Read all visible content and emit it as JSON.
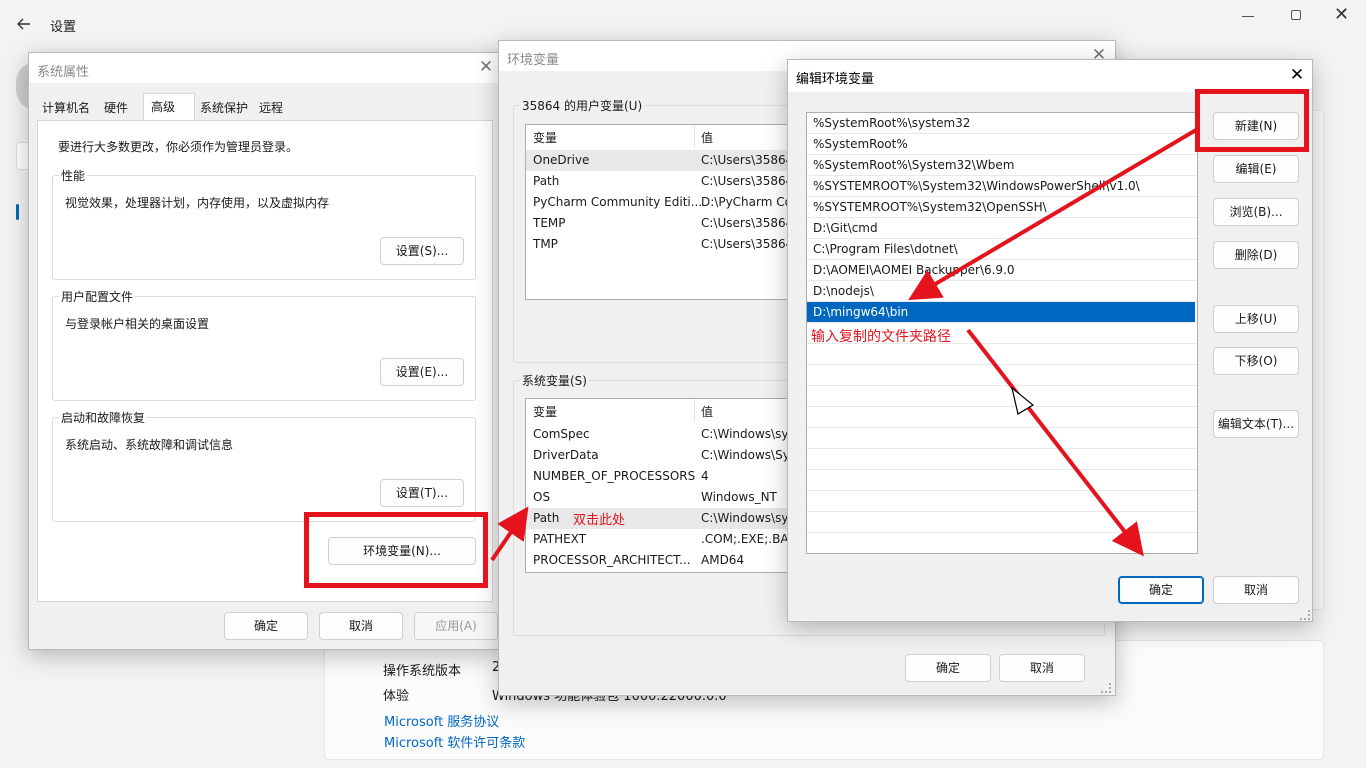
{
  "settings": {
    "title": "设置",
    "rows": [
      {
        "label": "操作系统版本",
        "value": "2"
      },
      {
        "label": "体验",
        "value": "Windows 功能体验包 1000.22000.0.0"
      }
    ],
    "links": [
      "Microsoft 服务协议",
      "Microsoft 软件许可条款"
    ]
  },
  "sysprops": {
    "title": "系统属性",
    "tabs": [
      "计算机名",
      "硬件",
      "高级",
      "系统保护",
      "远程"
    ],
    "active_tab": "高级",
    "notice": "要进行大多数更改，你必须作为管理员登录。",
    "groups": [
      {
        "title": "性能",
        "desc": "视觉效果，处理器计划，内存使用，以及虚拟内存",
        "button": "设置(S)..."
      },
      {
        "title": "用户配置文件",
        "desc": "与登录帐户相关的桌面设置",
        "button": "设置(E)..."
      },
      {
        "title": "启动和故障恢复",
        "desc": "系统启动、系统故障和调试信息",
        "button": "设置(T)..."
      }
    ],
    "env_button": "环境变量(N)...",
    "ok": "确定",
    "cancel": "取消",
    "apply": "应用(A)"
  },
  "envvars": {
    "title": "环境变量",
    "user_group": "35864 的用户变量(U)",
    "sys_group": "系统变量(S)",
    "col_var": "变量",
    "col_val": "值",
    "user_vars": [
      {
        "name": "OneDrive",
        "value": "C:\\Users\\35864"
      },
      {
        "name": "Path",
        "value": "C:\\Users\\35864"
      },
      {
        "name": "PyCharm Community Editi...",
        "value": "D:\\PyCharm Co"
      },
      {
        "name": "TEMP",
        "value": "C:\\Users\\35864"
      },
      {
        "name": "TMP",
        "value": "C:\\Users\\35864"
      }
    ],
    "sys_vars": [
      {
        "name": "ComSpec",
        "value": "C:\\Windows\\sy"
      },
      {
        "name": "DriverData",
        "value": "C:\\Windows\\Sy"
      },
      {
        "name": "NUMBER_OF_PROCESSORS",
        "value": "4"
      },
      {
        "name": "OS",
        "value": "Windows_NT"
      },
      {
        "name": "Path",
        "value": "C:\\Windows\\sy"
      },
      {
        "name": "PATHEXT",
        "value": ".COM;.EXE;.BAT"
      },
      {
        "name": "PROCESSOR_ARCHITECT...",
        "value": "AMD64"
      }
    ],
    "ok": "确定",
    "cancel": "取消"
  },
  "editenv": {
    "title": "编辑环境变量",
    "paths": [
      "%SystemRoot%\\system32",
      "%SystemRoot%",
      "%SystemRoot%\\System32\\Wbem",
      "%SYSTEMROOT%\\System32\\WindowsPowerShell\\v1.0\\",
      "%SYSTEMROOT%\\System32\\OpenSSH\\",
      "D:\\Git\\cmd",
      "C:\\Program Files\\dotnet\\",
      "D:\\AOMEI\\AOMEI Backupper\\6.9.0",
      "D:\\nodejs\\",
      "D:\\mingw64\\bin"
    ],
    "selected_index": 9,
    "buttons": {
      "new": "新建(N)",
      "edit": "编辑(E)",
      "browse": "浏览(B)...",
      "delete": "删除(D)",
      "up": "上移(U)",
      "down": "下移(O)",
      "edit_text": "编辑文本(T)..."
    },
    "ok": "确定",
    "cancel": "取消"
  },
  "annotations": {
    "double_click": "双击此处",
    "paste_hint": "输入复制的文件夹路径",
    "color": "#e4131d"
  }
}
